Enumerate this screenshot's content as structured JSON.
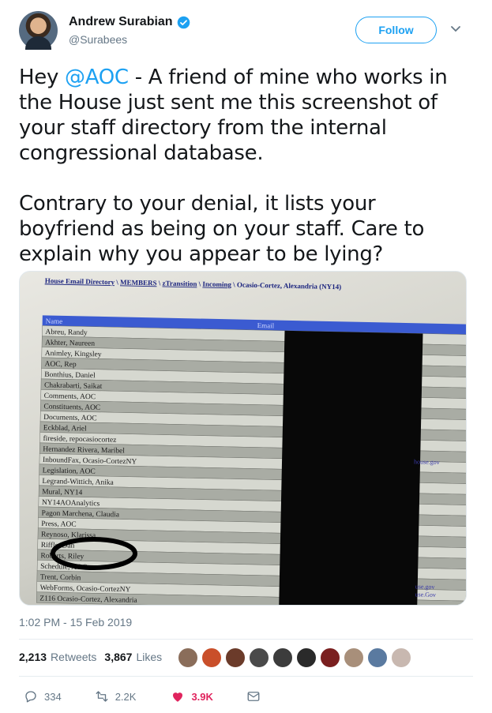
{
  "author": {
    "display_name": "Andrew Surabian",
    "handle": "@Surabees",
    "verified": true
  },
  "follow_button": {
    "label": "Follow"
  },
  "tweet": {
    "line1_prefix": "Hey ",
    "mention": "@AOC",
    "line1_rest": " - A friend of mine who works in the House just sent me this screenshot of your staff directory from the internal congressional database.\n\nContrary to your denial, it lists your boyfriend as being on your staff. Care to explain why you appear to be lying?"
  },
  "media": {
    "breadcrumb": [
      "House Email Directory",
      "MEMBERS",
      "zTransition",
      "Incoming"
    ],
    "breadcrumb_current": "Ocasio-Cortez, Alexandria (NY14)",
    "column_name_header": "Name",
    "column_email_header": "Email",
    "rows": [
      "Abreu, Randy",
      "Akhter, Naureen",
      "Animley, Kingsley",
      "AOC, Rep",
      "Bonthius, Daniel",
      "Chakrabarti, Saikat",
      "Comments, AOC",
      "Constituents, AOC",
      "Documents, AOC",
      "Eckblad, Ariel",
      "fireside, repocasiocortez",
      "Hernandez Rivera, Maribel",
      "InboundFax, Ocasio-CortezNY",
      "Legislation, AOC",
      "Legrand-Wittich, Anika",
      "Mural, NY14",
      "NY14AOAnalytics",
      "Pagon Marchena, Claudia",
      "Press, AOC",
      "Reynoso, Klarissa",
      "Riffle, Dan",
      "Roberts, Riley",
      "Schedule, AOC",
      "Trent, Corbin",
      "WebForms, Ocasio-CortezNY",
      "Z116 Ocasio-Cortez, Alexandria"
    ],
    "email_fragments": [
      "house.gov",
      "use.gov",
      "use.Gov"
    ]
  },
  "timestamp": "1:02 PM - 15 Feb 2019",
  "stats": {
    "retweets_count": "2,213",
    "retweets_label": "Retweets",
    "likes_count": "3,867",
    "likes_label": "Likes"
  },
  "likers": [
    "#8a6d5a",
    "#c94f2a",
    "#6b3b2a",
    "#4a4a4a",
    "#3c3c3c",
    "#2a2a2a",
    "#7a1f1f",
    "#a88f7a",
    "#5a7aa0",
    "#c8b8b0"
  ],
  "actions": {
    "replies": "334",
    "retweets": "2.2K",
    "likes": "3.9K"
  },
  "colors": {
    "brand": "#1da1f2",
    "like": "#e0245e",
    "muted": "#657786"
  }
}
